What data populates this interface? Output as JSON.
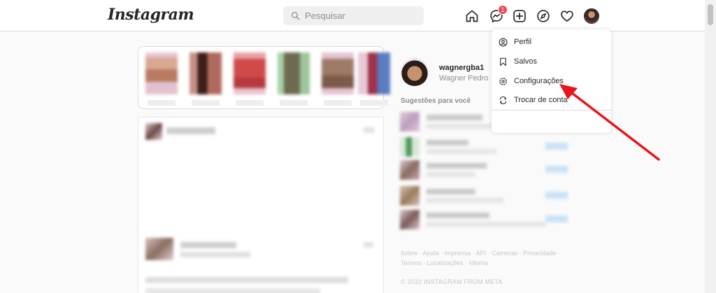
{
  "header": {
    "logo": "Instagram",
    "search_placeholder": "Pesquisar",
    "notification_count": "1",
    "icons": [
      "home-icon",
      "messenger-icon",
      "new-post-icon",
      "explore-icon",
      "activity-heart-icon",
      "profile-avatar"
    ]
  },
  "profile": {
    "username": "wagnergba1",
    "name": "Wagner Pedro"
  },
  "suggestions": {
    "title": "Sugestões para você"
  },
  "dropdown": {
    "items": [
      {
        "label": "Perfil",
        "icon": "profile-circle-icon"
      },
      {
        "label": "Salvos",
        "icon": "bookmark-icon"
      },
      {
        "label": "Configurações",
        "icon": "settings-gear-icon"
      },
      {
        "label": "Trocar de conta",
        "icon": "switch-account-icon"
      }
    ]
  },
  "footer": {
    "links": [
      "Sobre",
      "Ajuda",
      "Imprensa",
      "API",
      "Carreiras",
      "Privacidade",
      "Termos",
      "Localizações",
      "Idioma"
    ],
    "copyright": "© 2022 INSTAGRAM FROM META"
  },
  "colors": {
    "badge": "#ed4956",
    "annotation_arrow": "#e8151b",
    "follow_link": "#0095f6"
  }
}
